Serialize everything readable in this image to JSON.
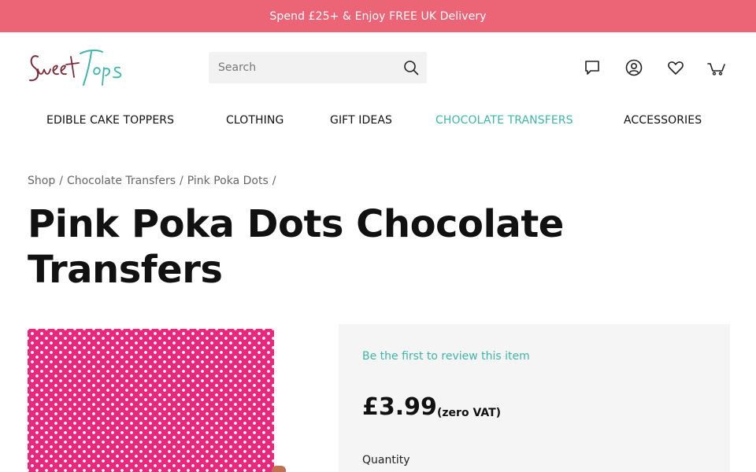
{
  "promo_bar": {
    "text": "Spend £25+ & Enjoy FREE UK Delivery"
  },
  "brand": {
    "name": "Sweet Tops",
    "accent": "#3fb5a9",
    "promo_color": "#eb6577",
    "script_color": "#7a2a3a"
  },
  "search": {
    "placeholder": "Search",
    "value": ""
  },
  "header_icons": [
    "chat-icon",
    "account-icon",
    "heart-icon",
    "basket-icon"
  ],
  "nav": {
    "items": [
      {
        "label": "EDIBLE CAKE TOPPERS",
        "active": false
      },
      {
        "label": "CLOTHING",
        "active": false
      },
      {
        "label": "GIFT IDEAS",
        "active": false
      },
      {
        "label": "CHOCOLATE TRANSFERS",
        "active": true
      },
      {
        "label": "ACCESSORIES",
        "active": false
      }
    ]
  },
  "breadcrumb": {
    "items": [
      "Shop",
      "Chocolate Transfers",
      "Pink Poka Dots"
    ],
    "separator": "/"
  },
  "product": {
    "title": "Pink Poka Dots Chocolate Transfers",
    "image_colors": {
      "background": "#e8287c",
      "dots": "#ffffff"
    },
    "review_link": "Be the first to review this item",
    "price": "£3.99",
    "vat_note": "(zero VAT)",
    "quantity_label": "Quantity"
  }
}
